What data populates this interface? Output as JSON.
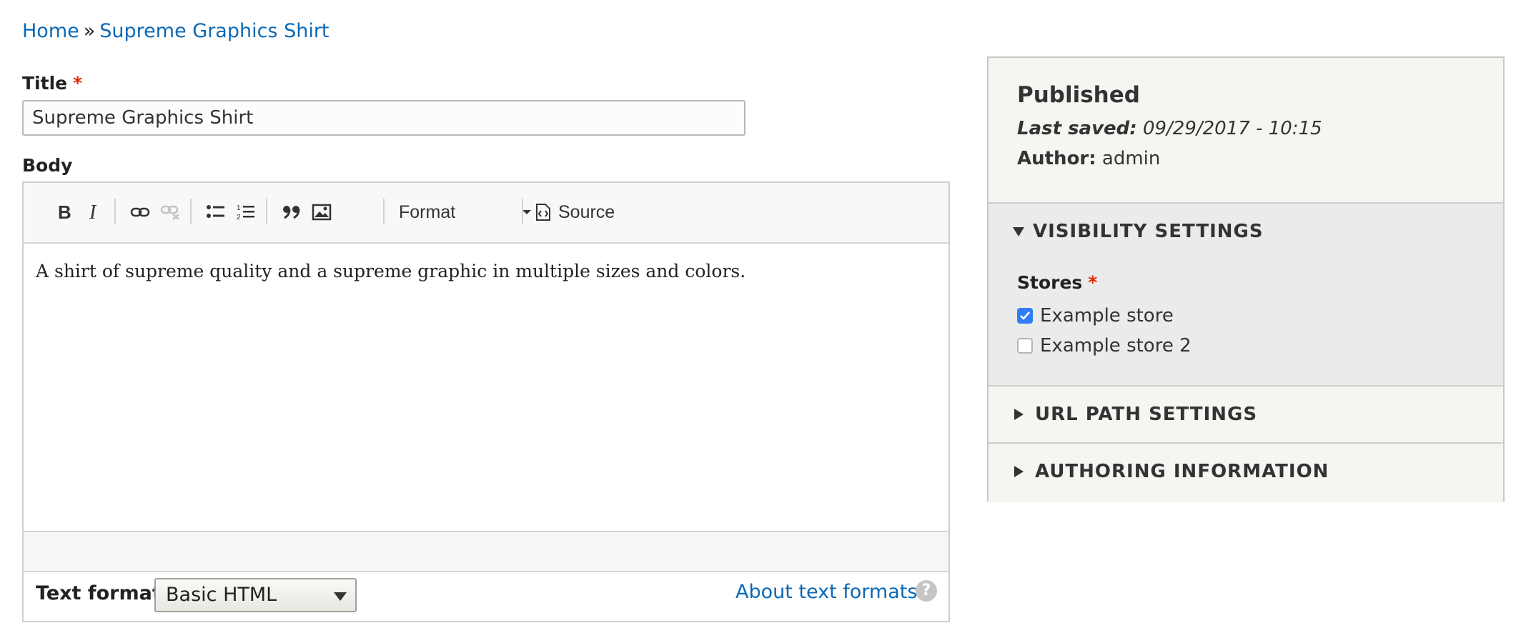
{
  "breadcrumb": {
    "home": "Home",
    "separator": "»",
    "current": "Supreme Graphics Shirt"
  },
  "form": {
    "title_label": "Title",
    "required_marker": "*",
    "title_value": "Supreme Graphics Shirt",
    "body_label": "Body"
  },
  "editor": {
    "toolbar": {
      "buttons": [
        "bold-icon",
        "italic-icon",
        "link-icon",
        "unlink-icon",
        "bulleted-list-icon",
        "numbered-list-icon",
        "blockquote-icon",
        "image-icon"
      ],
      "format_label": "Format",
      "source_label": "Source"
    },
    "content": "A shirt of supreme quality and a supreme graphic in multiple sizes and colors.",
    "text_format_label": "Text format",
    "text_format_value": "Basic HTML",
    "about_link": "About text formats",
    "help_glyph": "?"
  },
  "sidebar": {
    "status": "Published",
    "last_saved_label": "Last saved:",
    "last_saved_value": "09/29/2017 - 10:15",
    "author_label": "Author:",
    "author_value": "admin",
    "visibility": {
      "title": "VISIBILITY SETTINGS",
      "expanded": true,
      "stores_label": "Stores",
      "stores": [
        {
          "label": "Example store",
          "checked": true
        },
        {
          "label": "Example store 2",
          "checked": false
        }
      ]
    },
    "url_path": {
      "title": "URL PATH SETTINGS",
      "expanded": false
    },
    "authoring": {
      "title": "AUTHORING INFORMATION",
      "expanded": false
    }
  },
  "colors": {
    "link": "#0b68b4",
    "required": "#e32700",
    "checkbox_checked": "#2f7ef6"
  }
}
